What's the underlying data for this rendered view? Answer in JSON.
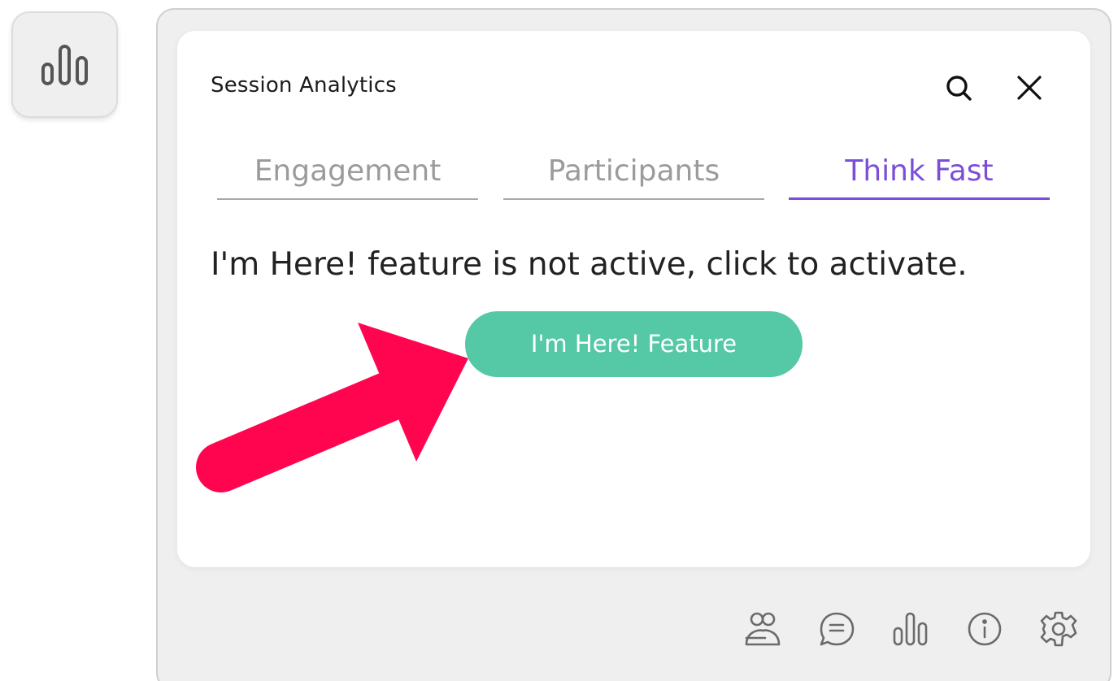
{
  "sidebar": {
    "analytics_button": {
      "icon": "bar-chart-icon"
    }
  },
  "card": {
    "title": "Session Analytics",
    "header_icons": [
      "search-icon",
      "close-icon"
    ],
    "tabs": [
      {
        "label": "Engagement",
        "active": false
      },
      {
        "label": "Participants",
        "active": false
      },
      {
        "label": "Think Fast",
        "active": true
      }
    ],
    "message": "I'm Here! feature is not active, click to activate.",
    "feature_button_label": "I'm Here! Feature"
  },
  "footer": {
    "icons": [
      "participants-icon",
      "chat-icon",
      "bar-chart-icon",
      "info-icon",
      "settings-icon"
    ]
  },
  "colors": {
    "accent": "#7c4dd9",
    "button": "#55c8a6",
    "arrow": "#ff0550",
    "panel_bg": "#efefef",
    "tab_inactive": "#9b9b9b"
  }
}
